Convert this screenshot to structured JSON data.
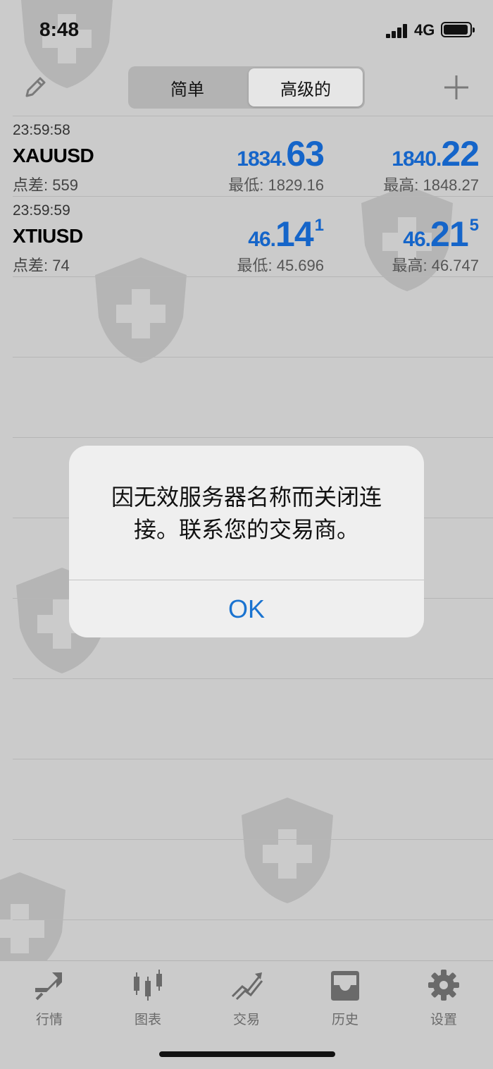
{
  "status_bar": {
    "time": "8:48",
    "network": "4G"
  },
  "toolbar": {
    "segments": [
      "简单",
      "高级的"
    ],
    "selected_segment": "高级的",
    "edit_icon": "pencil-icon",
    "add_icon": "plus-icon"
  },
  "quotes": [
    {
      "time": "23:59:58",
      "symbol": "XAUUSD",
      "spread": "点差: 559",
      "bid": {
        "prefix": "1834.",
        "big": "63",
        "sup": ""
      },
      "ask": {
        "prefix": "1840.",
        "big": "22",
        "sup": ""
      },
      "low": "最低: 1829.16",
      "high": "最高: 1848.27"
    },
    {
      "time": "23:59:59",
      "symbol": "XTIUSD",
      "spread": "点差: 74",
      "bid": {
        "prefix": "46.",
        "big": "14",
        "sup": "1"
      },
      "ask": {
        "prefix": "46.",
        "big": "21",
        "sup": "5"
      },
      "low": "最低: 45.696",
      "high": "最高: 46.747"
    }
  ],
  "dialog": {
    "message": "因无效服务器名称而关闭连接。联系您的交易商。",
    "ok_label": "OK"
  },
  "tabs": [
    {
      "label": "行情",
      "icon": "quotes-icon"
    },
    {
      "label": "图表",
      "icon": "chart-icon"
    },
    {
      "label": "交易",
      "icon": "trade-icon"
    },
    {
      "label": "历史",
      "icon": "history-icon"
    },
    {
      "label": "设置",
      "icon": "settings-icon"
    }
  ],
  "colors": {
    "background": "#cbcbcb",
    "price_blue": "#1565c9",
    "ok_blue": "#1a73d0",
    "dialog_bg": "#efefef"
  }
}
